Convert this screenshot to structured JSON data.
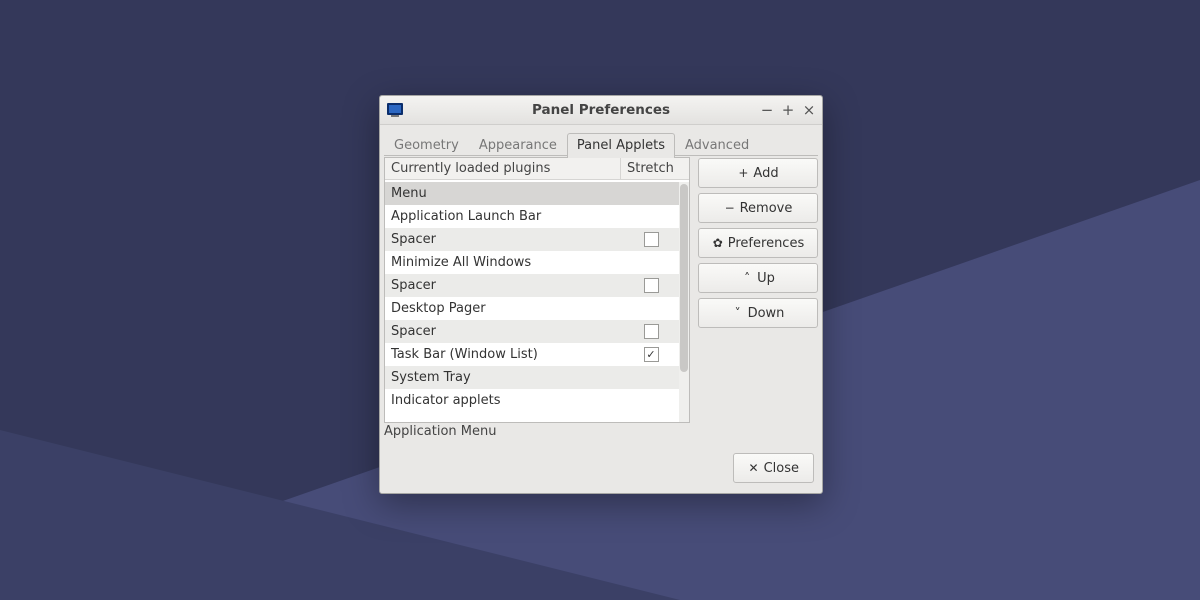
{
  "window": {
    "title": "Panel Preferences",
    "icon_glyph": "🖥"
  },
  "tabs": [
    {
      "label": "Geometry",
      "active": false
    },
    {
      "label": "Appearance",
      "active": false
    },
    {
      "label": "Panel Applets",
      "active": true
    },
    {
      "label": "Advanced",
      "active": false
    }
  ],
  "list": {
    "header_name": "Currently loaded plugins",
    "header_stretch": "Stretch",
    "rows": [
      {
        "name": "Menu",
        "stretch": null,
        "selected": true
      },
      {
        "name": "Application Launch Bar",
        "stretch": null
      },
      {
        "name": "Spacer",
        "stretch": false
      },
      {
        "name": "Minimize All Windows",
        "stretch": null
      },
      {
        "name": "Spacer",
        "stretch": false
      },
      {
        "name": "Desktop Pager",
        "stretch": null
      },
      {
        "name": "Spacer",
        "stretch": false
      },
      {
        "name": "Task Bar (Window List)",
        "stretch": true
      },
      {
        "name": "System Tray",
        "stretch": null
      },
      {
        "name": "Indicator applets",
        "stretch": null
      }
    ],
    "detail_label": "Application Menu"
  },
  "buttons": {
    "add": "Add",
    "remove": "Remove",
    "preferences": "Preferences",
    "up": "Up",
    "down": "Down",
    "close": "Close"
  }
}
